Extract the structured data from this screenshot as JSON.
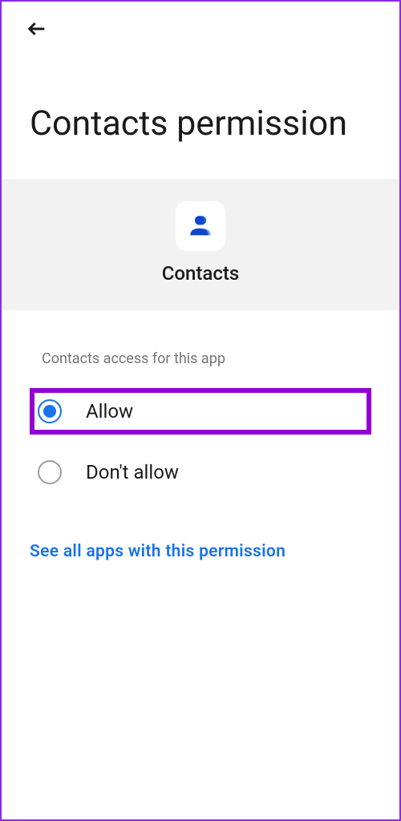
{
  "header": {
    "back_icon_name": "back-arrow"
  },
  "page": {
    "title": "Contacts permission"
  },
  "app": {
    "name": "Contacts",
    "icon_name": "contacts-icon"
  },
  "access": {
    "section_label": "Contacts access for this app",
    "options": [
      {
        "label": "Allow",
        "selected": true,
        "highlighted": true
      },
      {
        "label": "Don't allow",
        "selected": false,
        "highlighted": false
      }
    ]
  },
  "link": {
    "label": "See all apps with this permission"
  },
  "colors": {
    "accent": "#1a73e8",
    "highlight": "#9400d3"
  }
}
